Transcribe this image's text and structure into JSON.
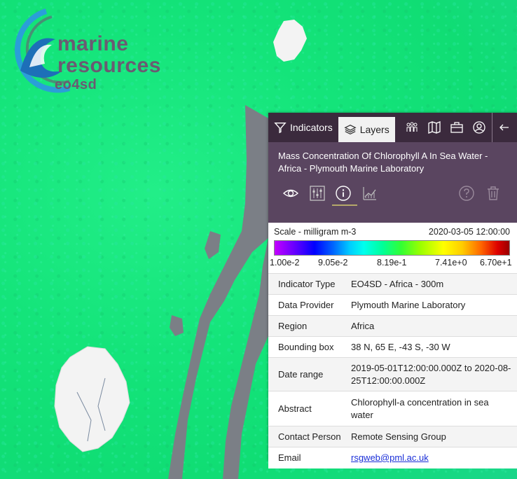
{
  "logo": {
    "line1": "marine",
    "line2": "resources",
    "line3": "eo4sd"
  },
  "toolbar": {
    "indicators_label": "Indicators",
    "layers_label": "Layers"
  },
  "layer": {
    "title": "Mass Concentration Of Chlorophyll A In Sea Water - Africa - Plymouth Marine Laboratory"
  },
  "scale": {
    "label": "Scale - milligram m-3",
    "timestamp": "2020-03-05 12:00:00",
    "ticks": [
      "1.00e-2",
      "9.05e-2",
      "8.19e-1",
      "7.41e+0",
      "6.70e+1"
    ]
  },
  "metadata": [
    {
      "key": "Indicator Type",
      "value": "EO4SD - Africa - 300m"
    },
    {
      "key": "Data Provider",
      "value": "Plymouth Marine Laboratory"
    },
    {
      "key": "Region",
      "value": "Africa"
    },
    {
      "key": "Bounding box",
      "value": "38 N, 65 E, -43 S, -30 W"
    },
    {
      "key": "Date range",
      "value": "2019-05-01T12:00:00.000Z to 2020-08-25T12:00:00.000Z"
    },
    {
      "key": "Abstract",
      "value": "Chlorophyll-a concentration in sea water"
    },
    {
      "key": "Contact Person",
      "value": "Remote Sensing Group"
    },
    {
      "key": "Email",
      "value": "rsgweb@pml.ac.uk"
    }
  ],
  "colors": {
    "panel_header": "#3b2a3d",
    "panel_sub": "#5a4560",
    "ocean": "#14e47a",
    "land": "#7b7f86"
  }
}
